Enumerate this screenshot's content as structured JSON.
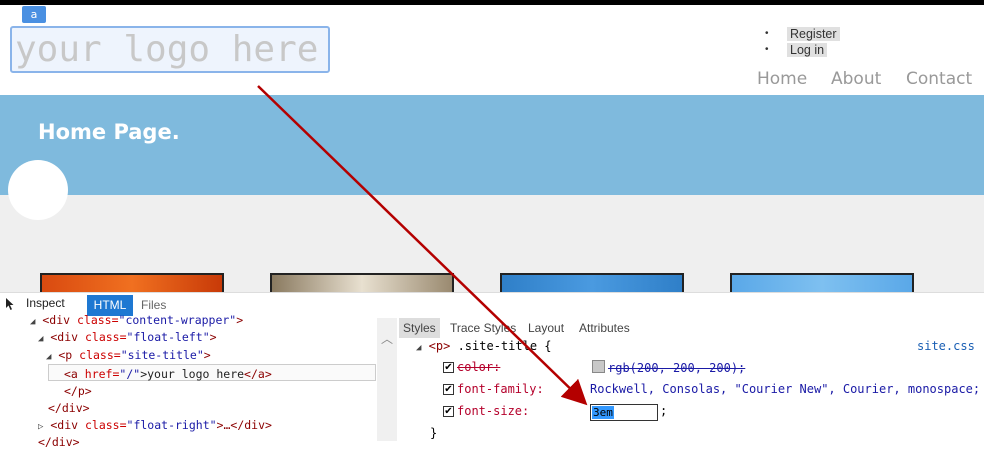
{
  "header": {
    "logo_badge": "a",
    "logo_text": "your logo here",
    "login_links": [
      "Register",
      "Log in"
    ],
    "nav": [
      "Home",
      "About",
      "Contact"
    ]
  },
  "banner": {
    "title": "Home Page."
  },
  "devtools": {
    "toolbar": {
      "inspect": "Inspect",
      "tab_html": "HTML",
      "tab_files": "Files"
    },
    "tree": {
      "l1_open": "<div ",
      "l1_attr": "class=",
      "l1_val": "\"content-wrapper\"",
      "l1_close": ">",
      "l2_open": "<div ",
      "l2_attr": "class=",
      "l2_val": "\"float-left\"",
      "l2_close": ">",
      "l3_open": "<p ",
      "l3_attr": "class=",
      "l3_val": "\"site-title\"",
      "l3_close": ">",
      "l4_open": "<a ",
      "l4_attr": "href=",
      "l4_val": "\"/\"",
      "l4_text": ">your logo here",
      "l4_close": "</a>",
      "l5": "</p>",
      "l6": "</div>",
      "l7_open": "<div ",
      "l7_attr": "class=",
      "l7_val": "\"float-right\"",
      "l7_close": ">…</div>",
      "l8": "</div>"
    },
    "styles_tabs": [
      "Styles",
      "Trace Styles",
      "Layout",
      "Attributes"
    ],
    "rule": {
      "selector_tag": "<p>",
      "selector": " .site-title {",
      "source": "site.css",
      "props": [
        {
          "name": "color:",
          "value": "rgb(200, 200, 200);",
          "struck": true
        },
        {
          "name": "font-family:",
          "value": "Rockwell, Consolas, \"Courier New\", Courier, monospace;",
          "struck": false
        },
        {
          "name": "font-size:",
          "value": "3em",
          "struck": false,
          "editing": true
        }
      ],
      "semicolon": ";",
      "close": "}"
    },
    "colors": {
      "accent": "#1e78d2",
      "banner": "#7fbadd",
      "arrow": "#b40000",
      "swatch": "#c8c8c8"
    }
  }
}
